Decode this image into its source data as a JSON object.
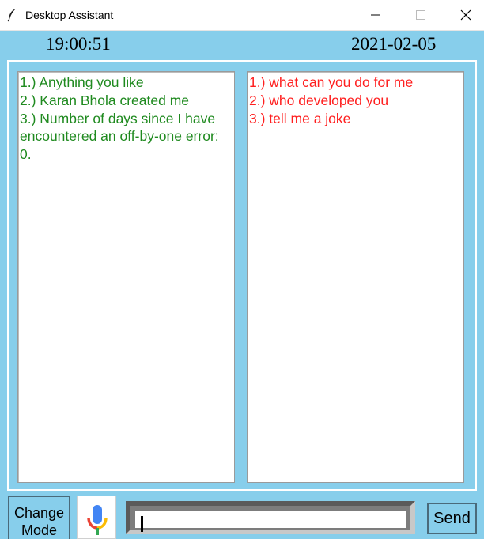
{
  "window": {
    "title": "Desktop Assistant",
    "controls": {
      "minimize_icon": "minimize-icon",
      "maximize_icon": "maximize-icon",
      "close_icon": "close-icon"
    }
  },
  "header": {
    "time": "19:00:51",
    "date": "2021-02-05"
  },
  "chat": {
    "assistant_responses": [
      "1.) Anything you like",
      "2.) Karan Bhola created me",
      "3.) Number of days since I have encountered an off-by-one error: 0."
    ],
    "user_queries": [
      "1.) what can you do for me",
      "2.) who developed you",
      "3.) tell me a joke"
    ]
  },
  "controls": {
    "change_mode_line1": "Change",
    "change_mode_line2": "Mode",
    "mic_icon": "microphone-icon",
    "input_value": "",
    "send_label": "Send"
  },
  "colors": {
    "background": "#87CEEB",
    "assistant_text": "#1f8a1f",
    "user_text": "#ff1f1f"
  }
}
